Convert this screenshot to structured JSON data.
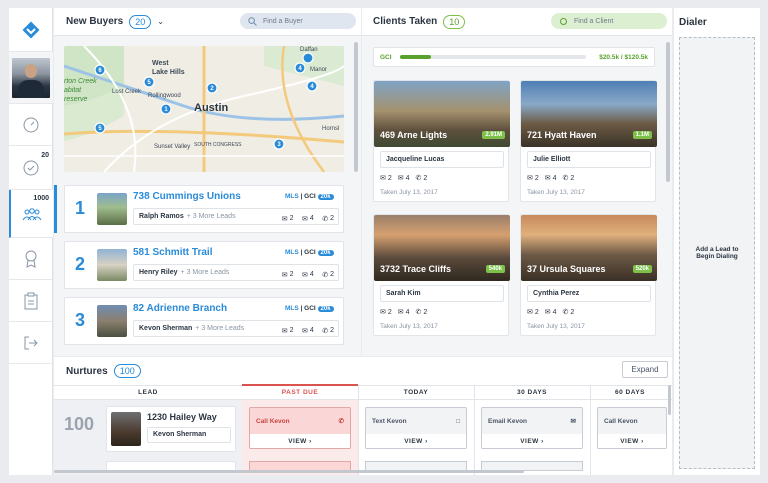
{
  "sidebar": {
    "tasks_count": "20",
    "leads_count": "1000"
  },
  "new_buyers": {
    "title": "New Buyers",
    "count": "20",
    "search_placeholder": "Find a Buyer",
    "map_labels": [
      "West",
      "Lake Hills",
      "Lost Creek",
      "Rollingwood",
      "Austin",
      "Sunset Valley",
      "SOUTH CONGRESS",
      "Daffan",
      "Hornsl",
      "rton Creek",
      "abitat",
      "reserve",
      "Manor"
    ],
    "buyers": [
      {
        "rank": "1",
        "address": "738 Cummings Unions",
        "name": "Ralph Ramos",
        "more": "+ 3 More Leads",
        "mls": "MLS",
        "gci": "GCI",
        "gci_value": "20k",
        "msgs": "2",
        "mails": "4",
        "calls": "2"
      },
      {
        "rank": "2",
        "address": "581 Schmitt Trail",
        "name": "Henry Riley",
        "more": "+ 3 More Leads",
        "mls": "MLS",
        "gci": "GCI",
        "gci_value": "20k",
        "msgs": "2",
        "mails": "4",
        "calls": "2"
      },
      {
        "rank": "3",
        "address": "82 Adrienne Branch",
        "name": "Kevon Sherman",
        "more": "+ 3 More Leads",
        "mls": "MLS",
        "gci": "GCI",
        "gci_value": "20k",
        "msgs": "2",
        "mails": "4",
        "calls": "2"
      }
    ]
  },
  "clients_taken": {
    "title": "Clients Taken",
    "count": "10",
    "search_placeholder": "Find a Client",
    "gci_label": "GCI",
    "gci_progress": 0.17,
    "gci_text": "$20.5k / $120.5k",
    "clients": [
      {
        "address": "469 Arne Lights",
        "price": "2.91M",
        "name": "Jacqueline Lucas",
        "msgs": "2",
        "mails": "4",
        "calls": "2",
        "taken": "Taken July 13, 2017"
      },
      {
        "address": "721 Hyatt Haven",
        "price": "1.1M",
        "name": "Julie Elliott",
        "msgs": "2",
        "mails": "4",
        "calls": "2",
        "taken": "Taken July 13, 2017"
      },
      {
        "address": "3732 Trace Cliffs",
        "price": "540k",
        "name": "Sarah Kim",
        "msgs": "2",
        "mails": "4",
        "calls": "2",
        "taken": "Taken July 13, 2017"
      },
      {
        "address": "37 Ursula Squares",
        "price": "520k",
        "name": "Cynthia Perez",
        "msgs": "2",
        "mails": "4",
        "calls": "2",
        "taken": "Taken July 13, 2017"
      }
    ]
  },
  "dialer": {
    "title": "Dialer",
    "empty_line1": "Add a Lead to",
    "empty_line2": "Begin Dialing"
  },
  "nurtures": {
    "title": "Nurtures",
    "count": "100",
    "expand_label": "Expand",
    "columns": [
      "LEAD",
      "PAST DUE",
      "TODAY",
      "30 DAYS",
      "60 DAYS"
    ],
    "row": {
      "rank": "100",
      "address": "1230 Hailey Way",
      "name": "Kevon Sherman",
      "past_due": "Call Kevon",
      "today": "Text Kevon",
      "days30": "Email Kevon",
      "days60": "Call Kevon",
      "view": "VIEW"
    }
  },
  "colors": {
    "accent": "#2a8bd8",
    "green": "#7dc04a",
    "past_due": "#d9534f"
  }
}
